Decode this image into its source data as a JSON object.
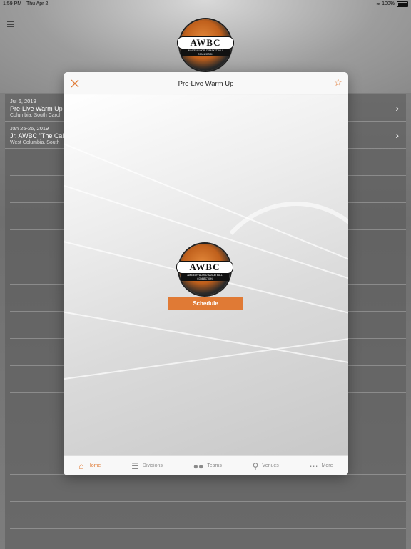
{
  "status_bar": {
    "time": "1:59 PM",
    "date": "Thu Apr 2",
    "battery": "100%"
  },
  "logo": {
    "text": "AWBC",
    "subtitle": "AMATEUR WORLD BASKETBALL CONNECTION"
  },
  "background_list": [
    {
      "date": "Jul 6, 2019",
      "name": "Pre-Live Warm Up",
      "location": "Columbia, South Carol"
    },
    {
      "date": "Jan 25-26, 2019",
      "name": "Jr. AWBC \"The Call",
      "location": "West Columbia, South"
    }
  ],
  "modal": {
    "title": "Pre-Live Warm Up",
    "schedule_label": "Schedule"
  },
  "tabbar": {
    "tabs": [
      {
        "label": "Home",
        "icon": "home-icon",
        "active": true
      },
      {
        "label": "Divisions",
        "icon": "list-icon",
        "active": false
      },
      {
        "label": "Teams",
        "icon": "people-icon",
        "active": false
      },
      {
        "label": "Venues",
        "icon": "location-pin-icon",
        "active": false
      },
      {
        "label": "More",
        "icon": "more-dots-icon",
        "active": false
      }
    ]
  },
  "colors": {
    "accent": "#e07a35",
    "inactive_tab": "#8a8a8a"
  }
}
